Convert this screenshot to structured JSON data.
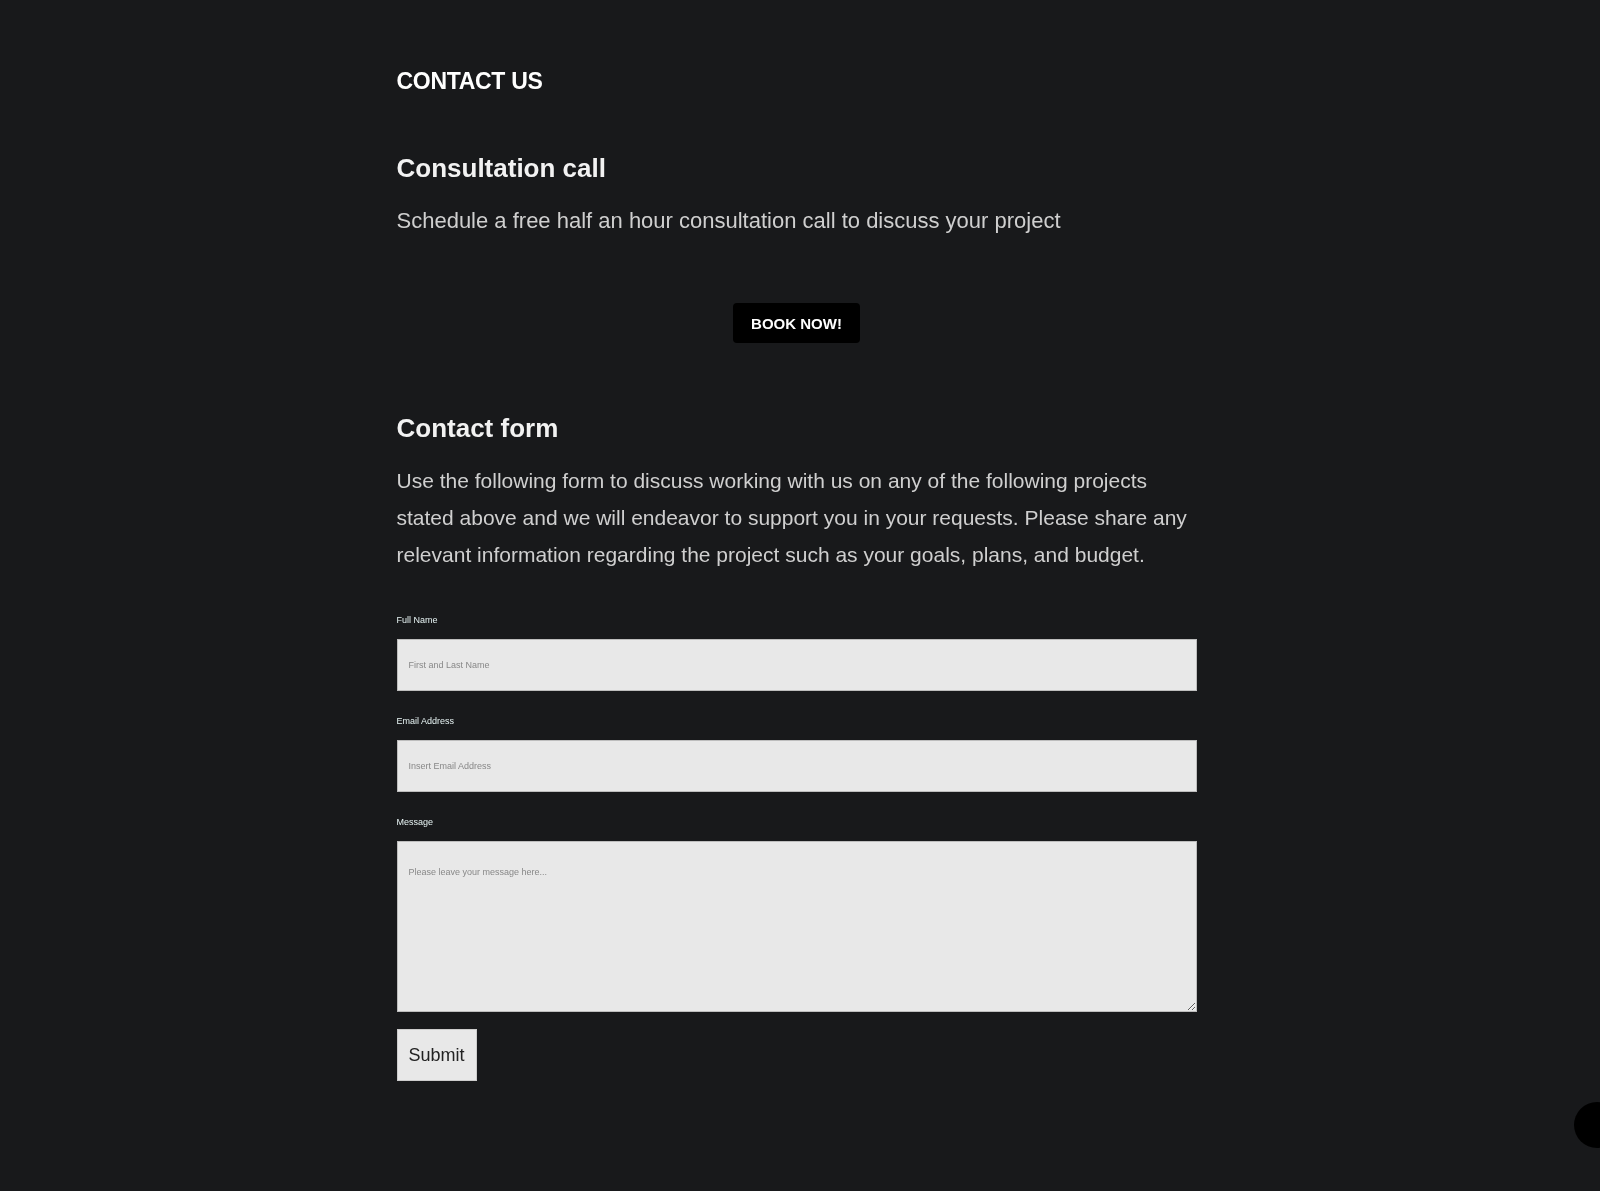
{
  "heading": "CONTACT US",
  "consultation": {
    "title": "Consultation call",
    "text": "Schedule a free half an hour consultation call to discuss your project",
    "button": "BOOK NOW!"
  },
  "contact_form": {
    "title": "Contact form",
    "text": "Use the following form to discuss working with us on any of the following projects stated above and we will endeavor to support you in your requests. Please share any relevant information regarding the project such as your goals, plans, and budget.",
    "fields": [
      {
        "kind": "input",
        "label": "Full Name",
        "placeholder": "First and Last Name"
      },
      {
        "kind": "input",
        "label": "Email Address",
        "placeholder": "Insert Email Address"
      },
      {
        "kind": "textarea",
        "label": "Message",
        "placeholder": "Please leave your message here..."
      }
    ],
    "submit": "Submit"
  }
}
